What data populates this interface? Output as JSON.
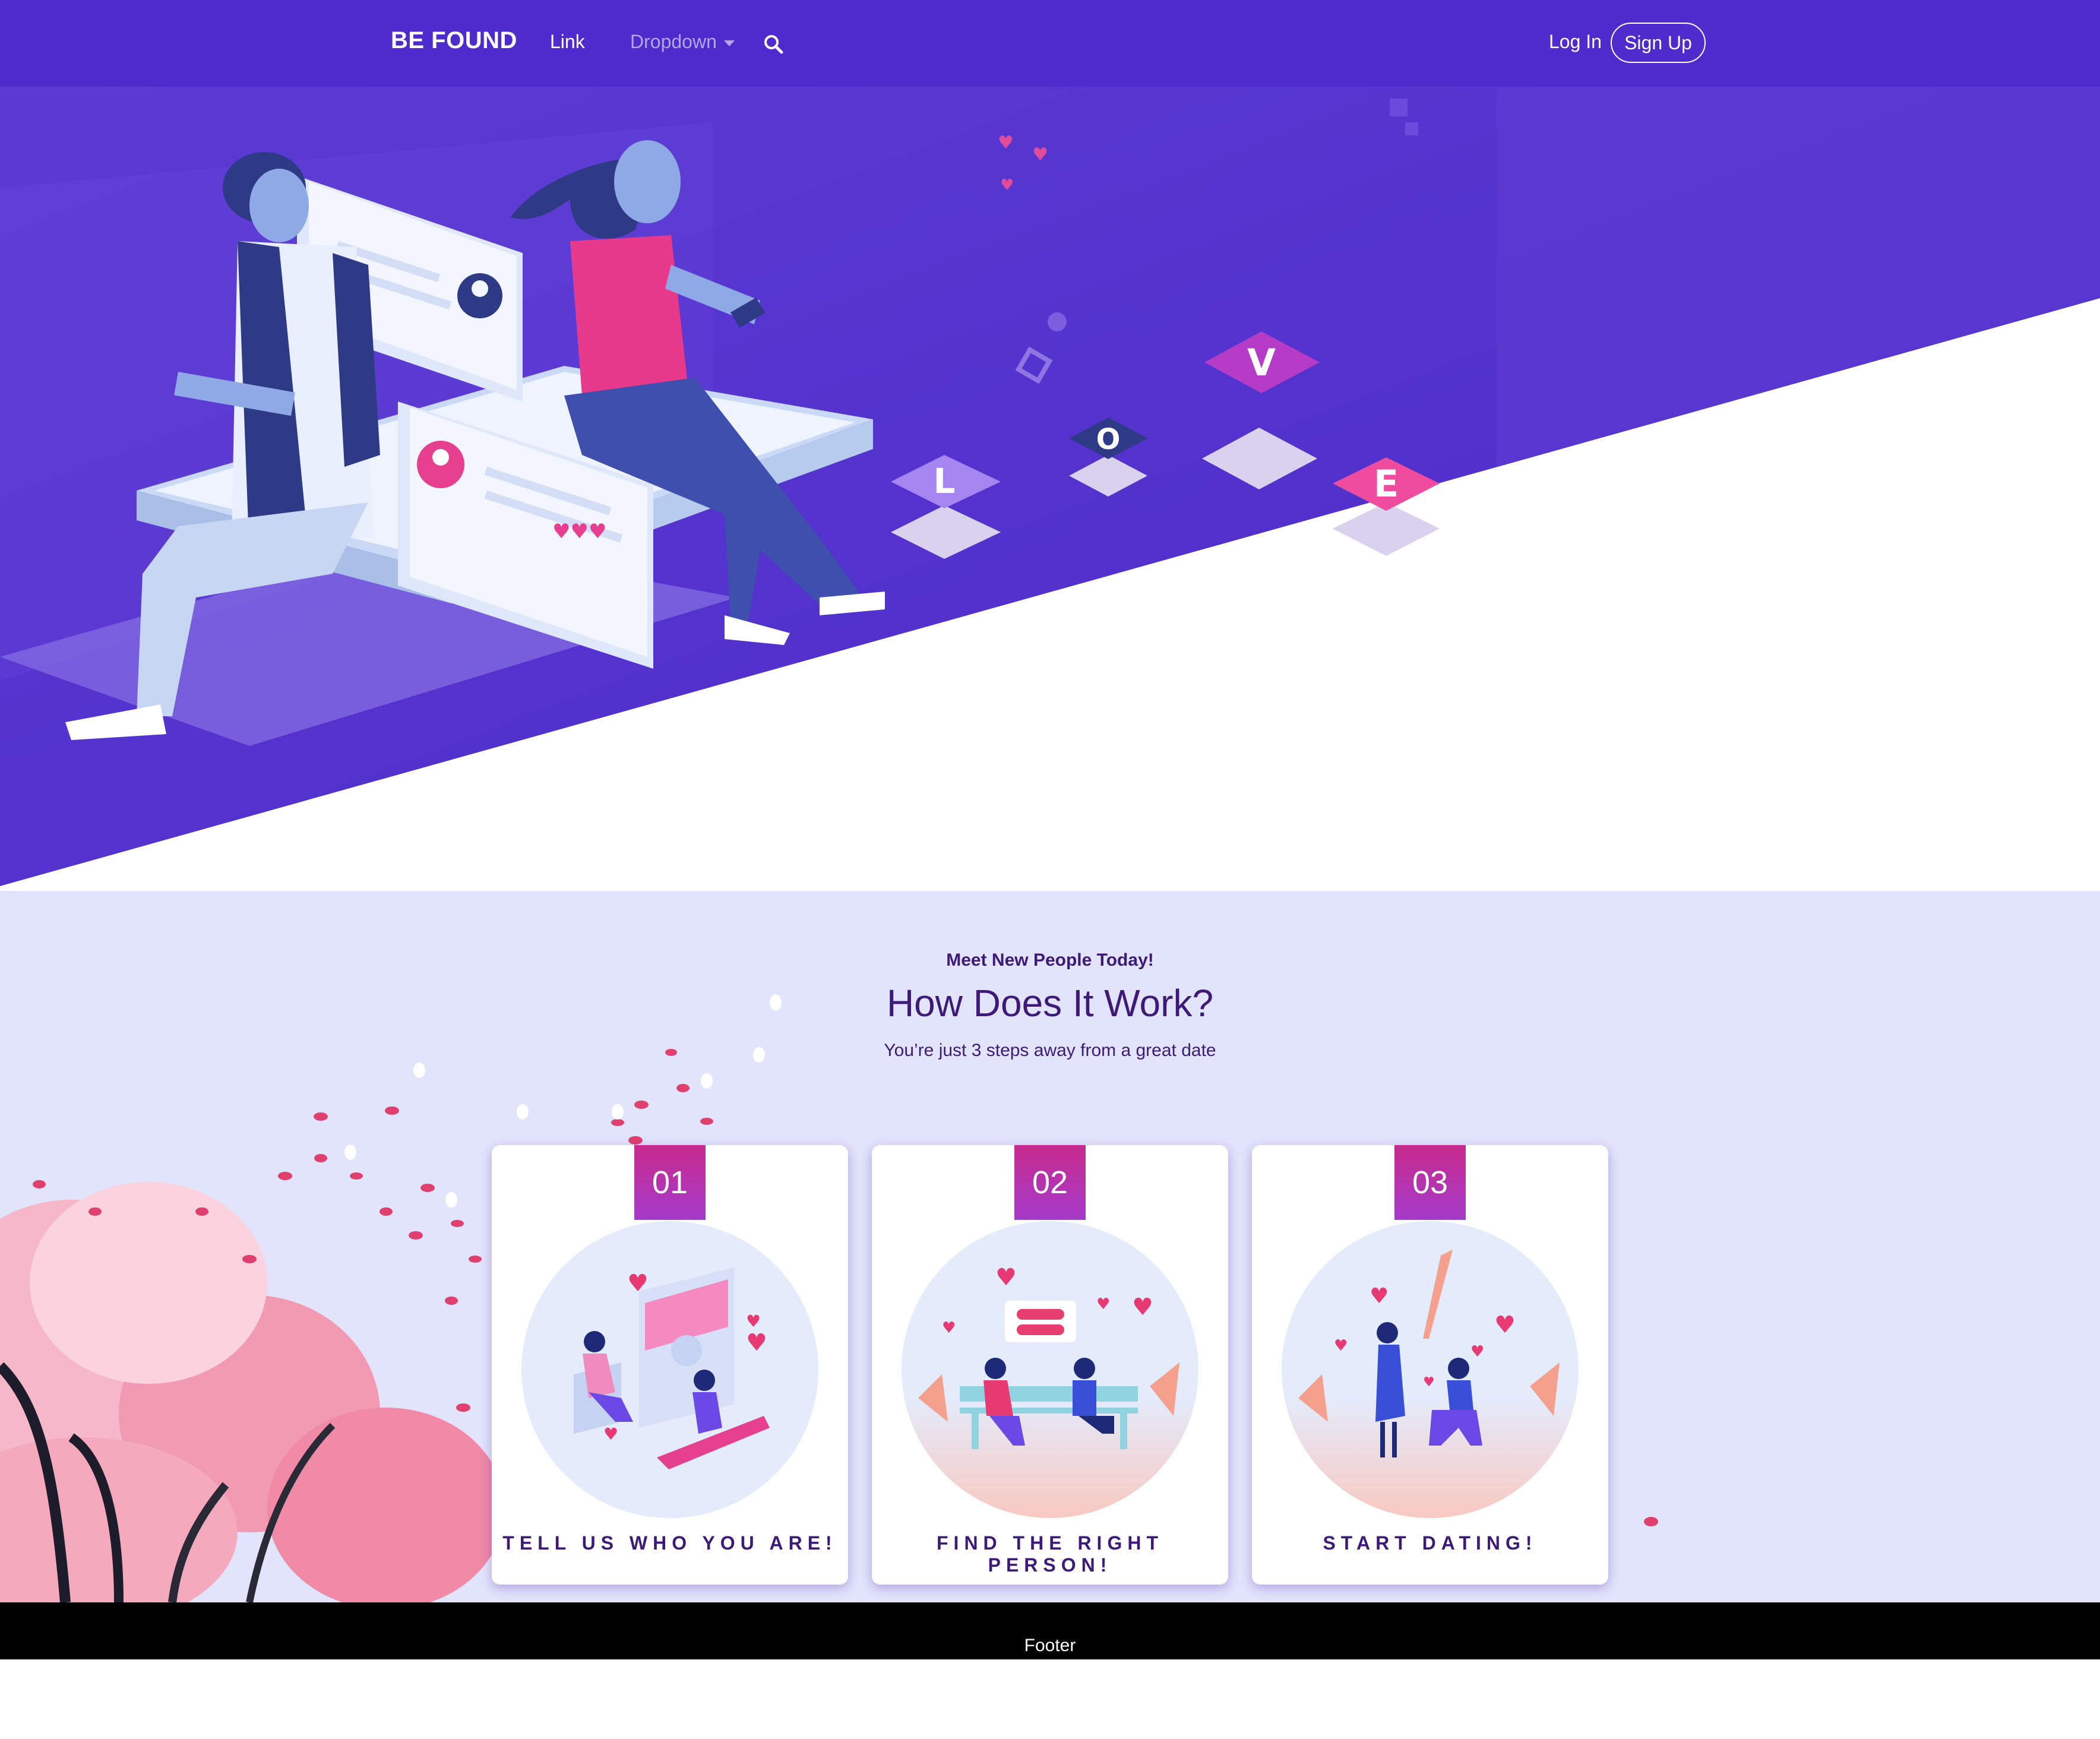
{
  "nav": {
    "brand": "BE FOUND",
    "link": "Link",
    "dropdown": "Dropdown",
    "login": "Log In",
    "signup": "Sign Up"
  },
  "hero": {
    "letters": [
      "L",
      "O",
      "V",
      "E"
    ]
  },
  "how": {
    "eyebrow": "Meet New People Today!",
    "title": "How Does It Work?",
    "subtitle": "You’re just 3 steps away from a great date",
    "steps": [
      {
        "number": "01",
        "label": "TELL US WHO YOU ARE!"
      },
      {
        "number": "02",
        "label": "FIND THE RIGHT PERSON!"
      },
      {
        "number": "03",
        "label": "START DATING!"
      }
    ]
  },
  "footer": {
    "text": "Footer"
  },
  "colors": {
    "navbar": "#4e2bcc",
    "hero_purple": "#5936cf",
    "accent_pink": "#e43d8f",
    "section_bg": "#e1e4fb",
    "heading": "#3d1a78",
    "footer_bg": "#000000"
  }
}
